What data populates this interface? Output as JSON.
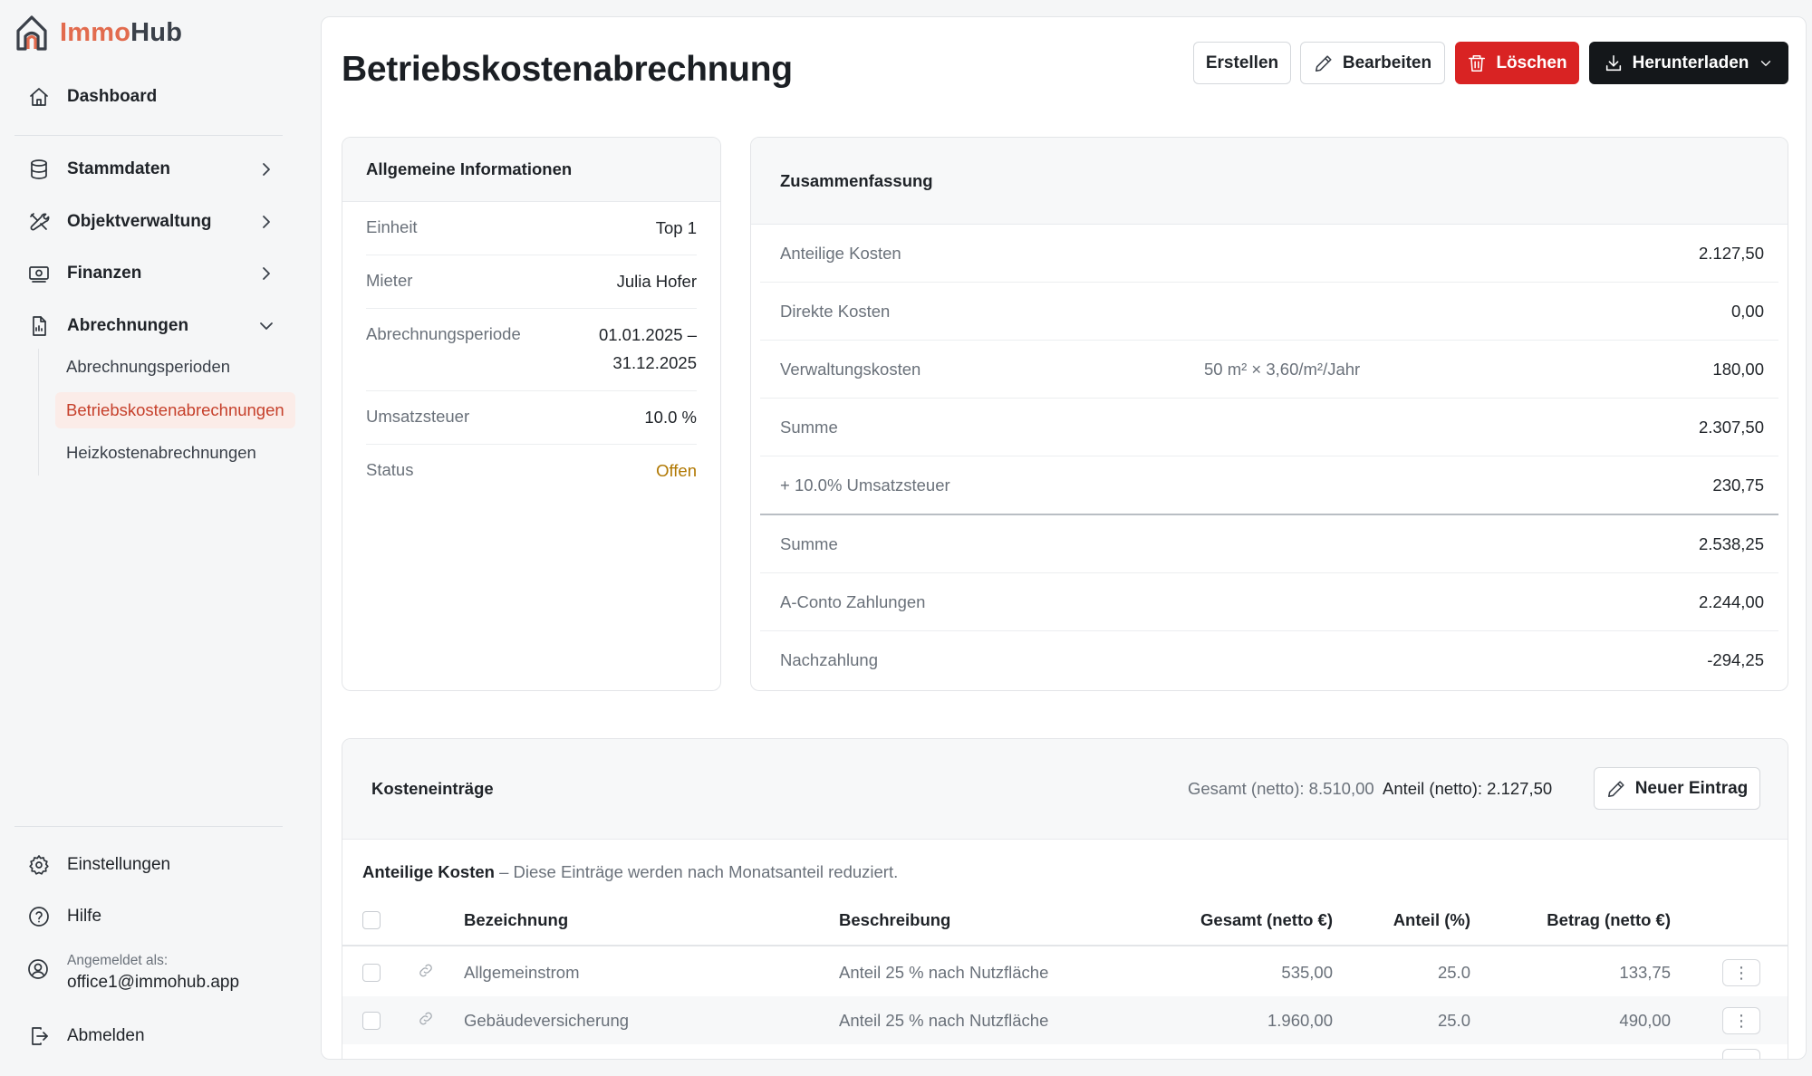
{
  "brand": {
    "part1": "Immo",
    "part2": "Hub"
  },
  "sidebar": {
    "dashboard": "Dashboard",
    "stammdaten": "Stammdaten",
    "objektverwaltung": "Objektverwaltung",
    "finanzen": "Finanzen",
    "abrechnungen": "Abrechnungen",
    "sub_items": [
      "Abrechnungsperioden",
      "Betriebskostenabrechnungen",
      "Heizkostenabrechnungen"
    ],
    "einstellungen": "Einstellungen",
    "hilfe": "Hilfe",
    "logged_in_label": "Angemeldet als:",
    "user_email": "office1@immohub.app",
    "logout": "Abmelden"
  },
  "header": {
    "title": "Betriebskostenabrechnung",
    "buttons": {
      "create": "Erstellen",
      "edit": "Bearbeiten",
      "delete": "Löschen",
      "download": "Herunterladen"
    }
  },
  "general_info": {
    "title": "Allgemeine Informationen",
    "rows": [
      {
        "label": "Einheit",
        "value": "Top 1"
      },
      {
        "label": "Mieter",
        "value": "Julia Hofer"
      },
      {
        "label": "Abrechnungsperiode",
        "value": "01.01.2025 –",
        "value2": "31.12.2025"
      },
      {
        "label": "Umsatzsteuer",
        "value": "10.0 %"
      },
      {
        "label": "Status",
        "value": "Offen"
      }
    ]
  },
  "summary": {
    "title": "Zusammenfassung",
    "rows": [
      {
        "label": "Anteilige Kosten",
        "detail": "",
        "value": "2.127,50"
      },
      {
        "label": "Direkte Kosten",
        "detail": "",
        "value": "0,00"
      },
      {
        "label": "Verwaltungskosten",
        "detail": "50 m² × 3,60/m²/Jahr",
        "value": "180,00"
      },
      {
        "label": "Summe",
        "detail": "",
        "value": "2.307,50"
      },
      {
        "label": "+ 10.0% Umsatzsteuer",
        "detail": "",
        "value": "230,75"
      },
      {
        "label": "Summe",
        "detail": "",
        "value": "2.538,25"
      },
      {
        "label": "A-Conto Zahlungen",
        "detail": "",
        "value": "2.244,00"
      },
      {
        "label": "Nachzahlung",
        "detail": "",
        "value": "-294,25"
      }
    ]
  },
  "costs": {
    "title": "Kosteneinträge",
    "total_net": "Gesamt (netto): 8.510,00",
    "share_net": "Anteil (netto): 2.127,50",
    "new_entry": "Neuer Eintrag",
    "section_title": "Anteilige Kosten",
    "section_desc": " – Diese Einträge werden nach Monatsanteil reduziert.",
    "columns": [
      "Bezeichnung",
      "Beschreibung",
      "Gesamt (netto €)",
      "Anteil (%)",
      "Betrag (netto €)"
    ],
    "rows": [
      {
        "name": "Allgemeinstrom",
        "desc": "Anteil 25 % nach Nutzfläche",
        "total": "535,00",
        "share": "25.0",
        "amount": "133,75"
      },
      {
        "name": "Gebäudeversicherung",
        "desc": "Anteil 25 % nach Nutzfläche",
        "total": "1.960,00",
        "share": "25.0",
        "amount": "490,00"
      }
    ]
  },
  "colors": {
    "accent": "#e26b4e",
    "danger": "#d92323",
    "dark": "#14171a",
    "status_open": "#b07700"
  }
}
